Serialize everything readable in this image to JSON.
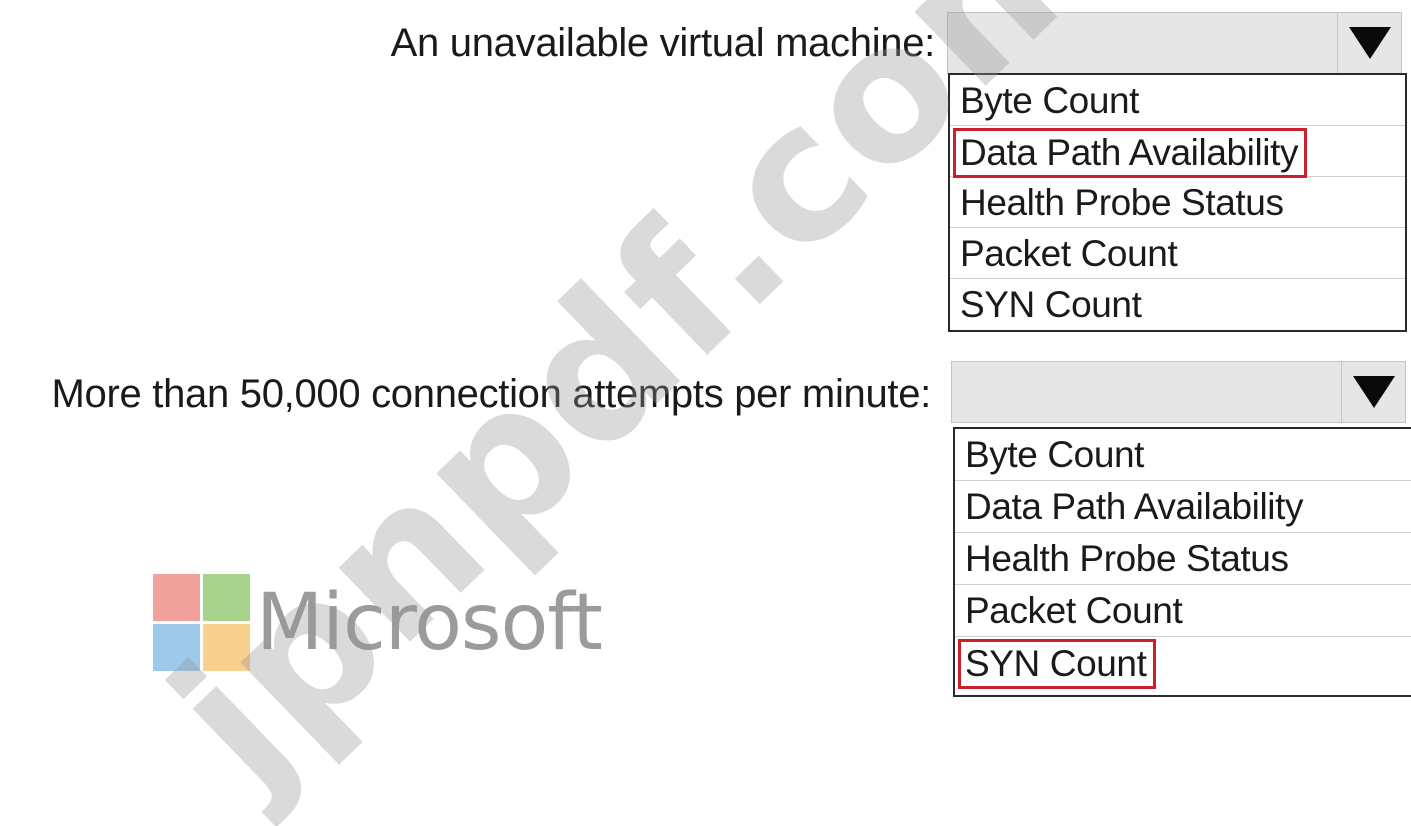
{
  "questions": [
    {
      "label": "An unavailable virtual machine:",
      "selected_value": "",
      "options": [
        "Byte Count",
        "Data Path Availability",
        "Health Probe Status",
        "Packet Count",
        "SYN Count"
      ],
      "highlighted_option": "Data Path Availability"
    },
    {
      "label": "More than 50,000 connection attempts per minute:",
      "selected_value": "",
      "options": [
        "Byte Count",
        "Data Path Availability",
        "Health Probe Status",
        "Packet Count",
        "SYN Count"
      ],
      "highlighted_option": "SYN Count"
    }
  ],
  "watermark": "jpnpdf.com",
  "logo": {
    "text": "Microsoft",
    "colors": [
      "#f1a29b",
      "#a8d38c",
      "#9ec9ea",
      "#f9d08e"
    ]
  },
  "colors": {
    "highlight_border": "#c8202d",
    "dropdown_bg": "#e6e6e6"
  },
  "icons": [
    "triangle-down-icon"
  ]
}
